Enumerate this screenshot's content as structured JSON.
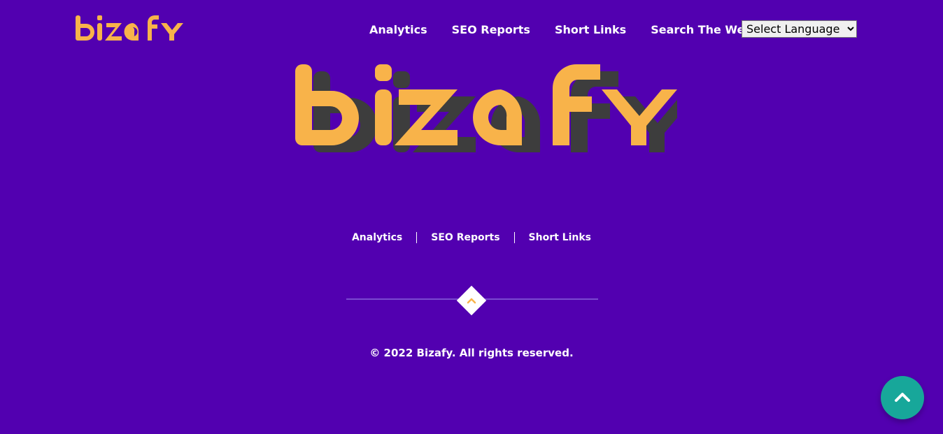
{
  "header": {
    "logo_text": "bizafy",
    "nav": [
      {
        "label": "Analytics"
      },
      {
        "label": "SEO Reports"
      },
      {
        "label": "Short Links"
      },
      {
        "label": "Search The Web"
      }
    ],
    "language_select": {
      "selected": "Select Language"
    }
  },
  "hero": {
    "logo_text": "bizafy"
  },
  "footer": {
    "links": [
      {
        "label": "Analytics"
      },
      {
        "label": "SEO Reports"
      },
      {
        "label": "Short Links"
      }
    ],
    "copyright": "© 2022 Bizafy. All rights reserved."
  },
  "icons": {
    "to_top_diamond": "chevron-up-icon",
    "scroll_top": "chevron-up-icon"
  },
  "colors": {
    "background": "#5200b0",
    "brand_orange": "#f8b34a",
    "shadow": "#3d3d3d",
    "scroll_button": "#17a79a"
  }
}
